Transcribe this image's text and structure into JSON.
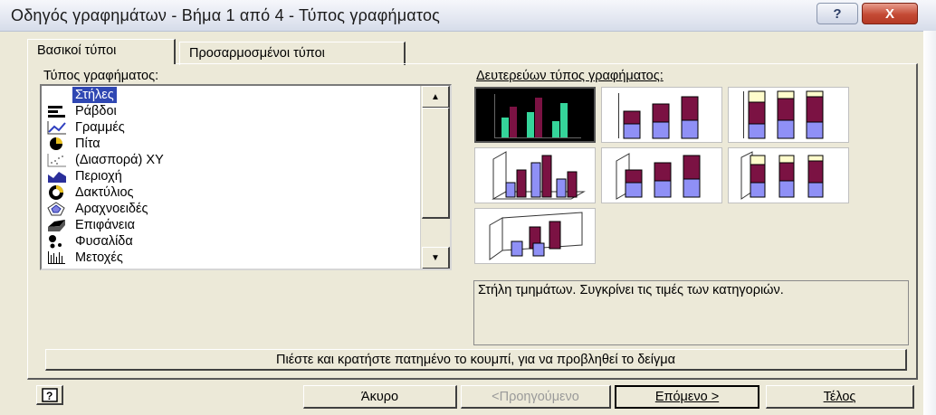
{
  "window": {
    "title": "Οδηγός γραφημάτων - Βήμα 1 από 4 - Τύπος γραφήματος",
    "help_glyph": "?",
    "close_glyph": "X"
  },
  "tabs": [
    {
      "label": "Βασικοί τύποι",
      "active": true
    },
    {
      "label": "Προσαρμοσμένοι τύποι",
      "active": false
    }
  ],
  "chart_type": {
    "label": "Τύπος γραφήματος:",
    "items": [
      {
        "label": "Στήλες",
        "icon": "column-chart-icon",
        "selected": true
      },
      {
        "label": "Ράβδοι",
        "icon": "bar-chart-icon"
      },
      {
        "label": "Γραμμές",
        "icon": "line-chart-icon"
      },
      {
        "label": "Πίτα",
        "icon": "pie-chart-icon"
      },
      {
        "label": "(Διασπορά) XY",
        "icon": "scatter-chart-icon"
      },
      {
        "label": "Περιοχή",
        "icon": "area-chart-icon"
      },
      {
        "label": "Δακτύλιος",
        "icon": "doughnut-chart-icon"
      },
      {
        "label": "Αραχνοειδές",
        "icon": "radar-chart-icon"
      },
      {
        "label": "Επιφάνεια",
        "icon": "surface-chart-icon"
      },
      {
        "label": "Φυσαλίδα",
        "icon": "bubble-chart-icon"
      },
      {
        "label": "Μετοχές",
        "icon": "stock-chart-icon"
      }
    ]
  },
  "subtype": {
    "label": "Δευτερεύων τύπος γραφήματος:",
    "options": [
      {
        "name": "clustered-column",
        "selected": true
      },
      {
        "name": "stacked-column"
      },
      {
        "name": "100-stacked-column"
      },
      {
        "name": "3d-clustered-column"
      },
      {
        "name": "3d-stacked-column"
      },
      {
        "name": "3d-100-stacked-column"
      },
      {
        "name": "3d-column"
      }
    ],
    "description": "Στήλη τμημάτων. Συγκρίνει τις τιμές των κατηγοριών."
  },
  "buttons": {
    "preview": "Πιέστε και κρατήστε πατημένο το κουμπί, για να προβληθεί το δείγμα",
    "cancel": "Άκυρο",
    "back": "<Προηγούμενο",
    "next": "Επόμενο >",
    "finish": "Τέλος"
  },
  "colors": {
    "selection": "#2f47b3",
    "series_blue": "#8f90f6",
    "series_maroon": "#7b1243",
    "series_cream": "#fffccc",
    "series_green": "#35d49a"
  }
}
